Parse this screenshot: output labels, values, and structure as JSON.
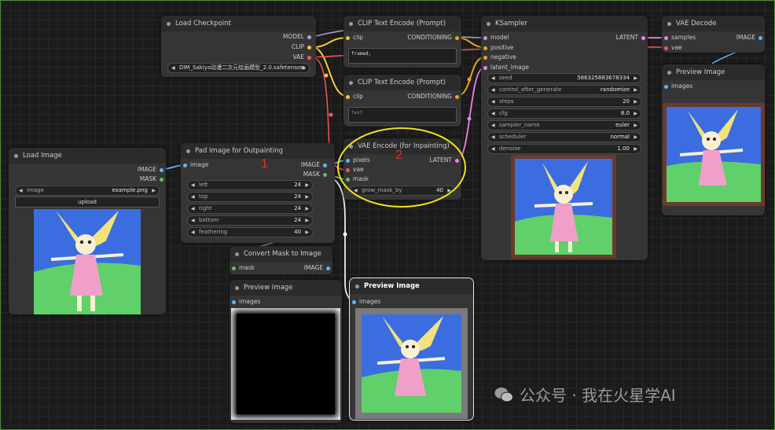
{
  "nodes": {
    "load_checkpoint": {
      "title": "Load Checkpoint",
      "outputs": [
        "MODEL",
        "CLIP",
        "VAE"
      ],
      "ckpt_value": "DIM_Sakiya动漫二次元绘画模型_2.0.safetensors"
    },
    "clip_text_encode_1": {
      "title": "CLIP Text Encode (Prompt)",
      "input": "clip",
      "output": "CONDITIONING",
      "text": "framed,"
    },
    "clip_text_encode_2": {
      "title": "CLIP Text Encode (Prompt)",
      "input": "clip",
      "output": "CONDITIONING",
      "text": "text"
    },
    "ksampler": {
      "title": "KSampler",
      "inputs": [
        "model",
        "positive",
        "negative",
        "latent_image"
      ],
      "output": "LATENT",
      "widgets": [
        {
          "label": "seed",
          "value": "586325883678334"
        },
        {
          "label": "control_after_generate",
          "value": "randomize"
        },
        {
          "label": "steps",
          "value": "20"
        },
        {
          "label": "cfg",
          "value": "8.0"
        },
        {
          "label": "sampler_name",
          "value": "euler"
        },
        {
          "label": "scheduler",
          "value": "normal"
        },
        {
          "label": "denoise",
          "value": "1.00"
        }
      ]
    },
    "vae_decode": {
      "title": "VAE Decode",
      "inputs": [
        "samples",
        "vae"
      ],
      "output": "IMAGE"
    },
    "preview_image_right": {
      "title": "Preview Image",
      "input": "images"
    },
    "load_image": {
      "title": "Load Image",
      "outputs": [
        "IMAGE",
        "MASK"
      ],
      "image_label": "image",
      "image_value": "example.png",
      "upload_label": "upload"
    },
    "pad_image": {
      "title": "Pad Image for Outpainting",
      "input": "image",
      "outputs": [
        "IMAGE",
        "MASK"
      ],
      "widgets": [
        {
          "label": "left",
          "value": "24"
        },
        {
          "label": "top",
          "value": "24"
        },
        {
          "label": "right",
          "value": "24"
        },
        {
          "label": "bottom",
          "value": "24"
        },
        {
          "label": "feathering",
          "value": "40"
        }
      ]
    },
    "vae_encode_inpaint": {
      "title": "VAE Encode (for Inpainting)",
      "inputs": [
        "pixels",
        "vae",
        "mask"
      ],
      "output": "LATENT",
      "widget": {
        "label": "grow_mask_by",
        "value": "40"
      }
    },
    "convert_mask": {
      "title": "Convert Mask to Image",
      "input": "mask",
      "output": "IMAGE"
    },
    "preview_image_mask": {
      "title": "Preview Image",
      "input": "images"
    },
    "preview_image_padded": {
      "title": "Preview Image",
      "input": "images"
    }
  },
  "annotations": [
    "1",
    "2"
  ],
  "watermark": "公众号 · 我在火星学AI",
  "colors": {
    "model": "#b39ddb",
    "clip": "#f5c542",
    "vae": "#ef5a5a",
    "conditioning": "#e8a030",
    "latent": "#f080f0",
    "image": "#64b5f6",
    "mask": "#66bb6a",
    "highlight": "#f0e020",
    "annotation": "#e03030"
  }
}
